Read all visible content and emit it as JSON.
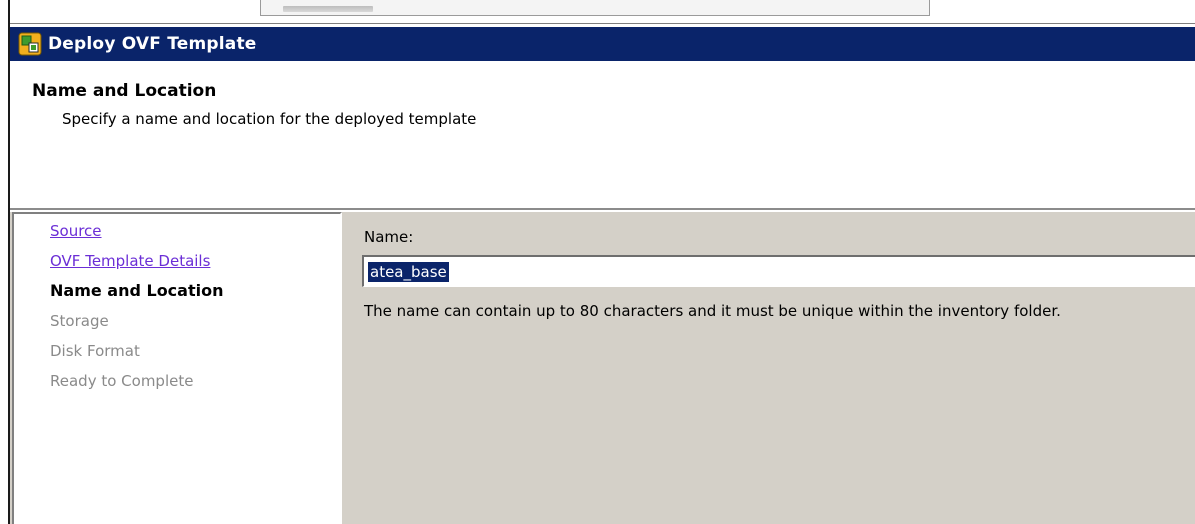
{
  "window": {
    "title": "Deploy OVF Template",
    "icon": "vsphere-ovf-icon"
  },
  "header": {
    "title": "Name and Location",
    "subtitle": "Specify a name and location for the deployed template"
  },
  "steps": [
    {
      "label": "Source",
      "state": "completed-link"
    },
    {
      "label": "OVF Template Details",
      "state": "completed-link"
    },
    {
      "label": "Name and Location",
      "state": "current"
    },
    {
      "label": "Storage",
      "state": "pending"
    },
    {
      "label": "Disk Format",
      "state": "pending"
    },
    {
      "label": "Ready to Complete",
      "state": "pending"
    }
  ],
  "form": {
    "name_label": "Name:",
    "name_value": "atea_base",
    "hint": "The name can contain up to 80 characters and it must be unique within the inventory folder."
  },
  "colors": {
    "titlebar": "#0a246a",
    "panel": "#d4d0c8",
    "link": "#6b2ed6",
    "disabled_text": "#8a8a8a",
    "selection": "#0a246a"
  }
}
